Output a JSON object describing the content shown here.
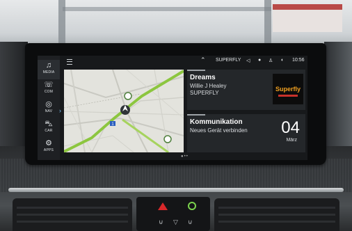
{
  "status_bar": {
    "source": "SUPERFLY",
    "time": "10:56"
  },
  "sidebar": {
    "items": [
      {
        "label": "MEDIA",
        "icon": "music-note-icon"
      },
      {
        "label": "COM",
        "icon": "phone-icon"
      },
      {
        "label": "NAV",
        "icon": "navigation-icon"
      },
      {
        "label": "CAR",
        "icon": "car-icon"
      },
      {
        "label": "APPS",
        "icon": "apps-icon"
      }
    ]
  },
  "media_tile": {
    "title": "Dreams",
    "artist": "Willie J Healey",
    "station": "SUPERFLY",
    "logo_text": "Superfly"
  },
  "com_tile": {
    "title": "Kommunikation",
    "subtitle": "Neues Gerät verbinden",
    "day": "04",
    "month": "März"
  },
  "map": {
    "route_marker": "1"
  },
  "colors": {
    "accent_blue": "#7dc7ff",
    "route_green": "#7bd34d",
    "hazard_red": "#d8282a"
  }
}
